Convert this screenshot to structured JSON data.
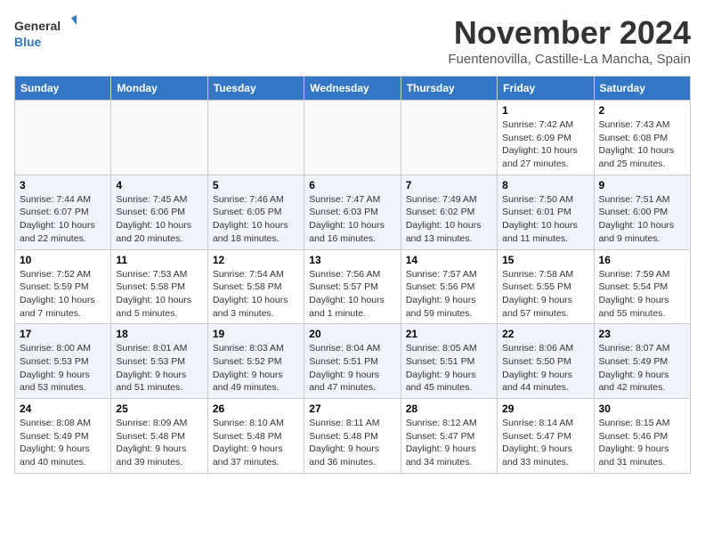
{
  "logo": {
    "line1": "General",
    "line2": "Blue"
  },
  "title": "November 2024",
  "location": "Fuentenovilla, Castille-La Mancha, Spain",
  "weekdays": [
    "Sunday",
    "Monday",
    "Tuesday",
    "Wednesday",
    "Thursday",
    "Friday",
    "Saturday"
  ],
  "weeks": [
    [
      {
        "day": "",
        "info": ""
      },
      {
        "day": "",
        "info": ""
      },
      {
        "day": "",
        "info": ""
      },
      {
        "day": "",
        "info": ""
      },
      {
        "day": "",
        "info": ""
      },
      {
        "day": "1",
        "info": "Sunrise: 7:42 AM\nSunset: 6:09 PM\nDaylight: 10 hours and 27 minutes."
      },
      {
        "day": "2",
        "info": "Sunrise: 7:43 AM\nSunset: 6:08 PM\nDaylight: 10 hours and 25 minutes."
      }
    ],
    [
      {
        "day": "3",
        "info": "Sunrise: 7:44 AM\nSunset: 6:07 PM\nDaylight: 10 hours and 22 minutes."
      },
      {
        "day": "4",
        "info": "Sunrise: 7:45 AM\nSunset: 6:06 PM\nDaylight: 10 hours and 20 minutes."
      },
      {
        "day": "5",
        "info": "Sunrise: 7:46 AM\nSunset: 6:05 PM\nDaylight: 10 hours and 18 minutes."
      },
      {
        "day": "6",
        "info": "Sunrise: 7:47 AM\nSunset: 6:03 PM\nDaylight: 10 hours and 16 minutes."
      },
      {
        "day": "7",
        "info": "Sunrise: 7:49 AM\nSunset: 6:02 PM\nDaylight: 10 hours and 13 minutes."
      },
      {
        "day": "8",
        "info": "Sunrise: 7:50 AM\nSunset: 6:01 PM\nDaylight: 10 hours and 11 minutes."
      },
      {
        "day": "9",
        "info": "Sunrise: 7:51 AM\nSunset: 6:00 PM\nDaylight: 10 hours and 9 minutes."
      }
    ],
    [
      {
        "day": "10",
        "info": "Sunrise: 7:52 AM\nSunset: 5:59 PM\nDaylight: 10 hours and 7 minutes."
      },
      {
        "day": "11",
        "info": "Sunrise: 7:53 AM\nSunset: 5:58 PM\nDaylight: 10 hours and 5 minutes."
      },
      {
        "day": "12",
        "info": "Sunrise: 7:54 AM\nSunset: 5:58 PM\nDaylight: 10 hours and 3 minutes."
      },
      {
        "day": "13",
        "info": "Sunrise: 7:56 AM\nSunset: 5:57 PM\nDaylight: 10 hours and 1 minute."
      },
      {
        "day": "14",
        "info": "Sunrise: 7:57 AM\nSunset: 5:56 PM\nDaylight: 9 hours and 59 minutes."
      },
      {
        "day": "15",
        "info": "Sunrise: 7:58 AM\nSunset: 5:55 PM\nDaylight: 9 hours and 57 minutes."
      },
      {
        "day": "16",
        "info": "Sunrise: 7:59 AM\nSunset: 5:54 PM\nDaylight: 9 hours and 55 minutes."
      }
    ],
    [
      {
        "day": "17",
        "info": "Sunrise: 8:00 AM\nSunset: 5:53 PM\nDaylight: 9 hours and 53 minutes."
      },
      {
        "day": "18",
        "info": "Sunrise: 8:01 AM\nSunset: 5:53 PM\nDaylight: 9 hours and 51 minutes."
      },
      {
        "day": "19",
        "info": "Sunrise: 8:03 AM\nSunset: 5:52 PM\nDaylight: 9 hours and 49 minutes."
      },
      {
        "day": "20",
        "info": "Sunrise: 8:04 AM\nSunset: 5:51 PM\nDaylight: 9 hours and 47 minutes."
      },
      {
        "day": "21",
        "info": "Sunrise: 8:05 AM\nSunset: 5:51 PM\nDaylight: 9 hours and 45 minutes."
      },
      {
        "day": "22",
        "info": "Sunrise: 8:06 AM\nSunset: 5:50 PM\nDaylight: 9 hours and 44 minutes."
      },
      {
        "day": "23",
        "info": "Sunrise: 8:07 AM\nSunset: 5:49 PM\nDaylight: 9 hours and 42 minutes."
      }
    ],
    [
      {
        "day": "24",
        "info": "Sunrise: 8:08 AM\nSunset: 5:49 PM\nDaylight: 9 hours and 40 minutes."
      },
      {
        "day": "25",
        "info": "Sunrise: 8:09 AM\nSunset: 5:48 PM\nDaylight: 9 hours and 39 minutes."
      },
      {
        "day": "26",
        "info": "Sunrise: 8:10 AM\nSunset: 5:48 PM\nDaylight: 9 hours and 37 minutes."
      },
      {
        "day": "27",
        "info": "Sunrise: 8:11 AM\nSunset: 5:48 PM\nDaylight: 9 hours and 36 minutes."
      },
      {
        "day": "28",
        "info": "Sunrise: 8:12 AM\nSunset: 5:47 PM\nDaylight: 9 hours and 34 minutes."
      },
      {
        "day": "29",
        "info": "Sunrise: 8:14 AM\nSunset: 5:47 PM\nDaylight: 9 hours and 33 minutes."
      },
      {
        "day": "30",
        "info": "Sunrise: 8:15 AM\nSunset: 5:46 PM\nDaylight: 9 hours and 31 minutes."
      }
    ]
  ]
}
